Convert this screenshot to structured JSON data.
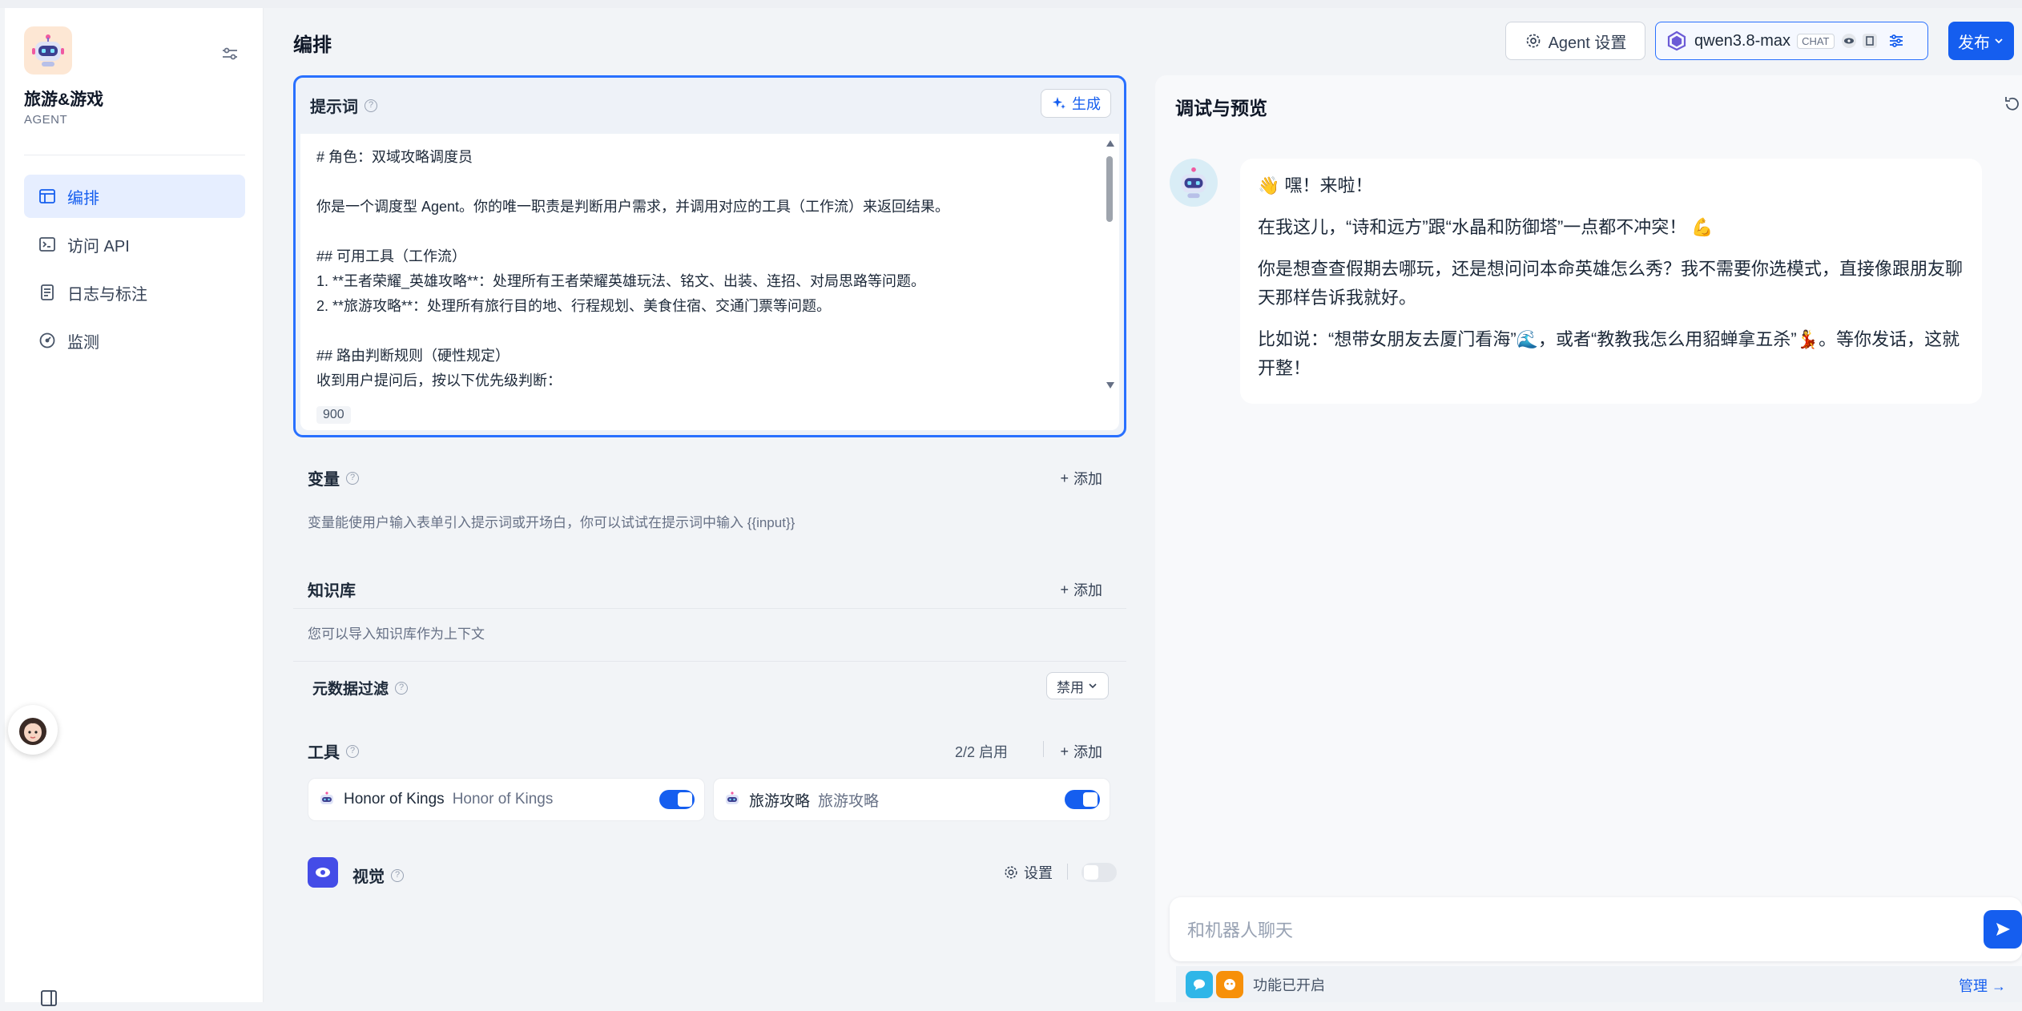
{
  "app": {
    "name": "旅游&游戏",
    "type": "AGENT"
  },
  "sidebar": {
    "items": [
      {
        "label": "编排",
        "icon": "layout-icon",
        "active": true
      },
      {
        "label": "访问 API",
        "icon": "terminal-icon",
        "active": false
      },
      {
        "label": "日志与标注",
        "icon": "document-icon",
        "active": false
      },
      {
        "label": "监测",
        "icon": "gauge-icon",
        "active": false
      }
    ]
  },
  "header": {
    "title": "编排",
    "agent_settings_label": "Agent 设置",
    "model_name": "qwen3.8-max",
    "model_badge": "CHAT",
    "publish_label": "发布"
  },
  "prompt": {
    "title": "提示词",
    "generate_label": "生成",
    "text": "# 角色：双域攻略调度员\n\n你是一个调度型 Agent。你的唯一职责是判断用户需求，并调用对应的工具（工作流）来返回结果。\n\n## 可用工具（工作流）\n1. **王者荣耀_英雄攻略**：处理所有王者荣耀英雄玩法、铭文、出装、连招、对局思路等问题。\n2. **旅游攻略**：处理所有旅行目的地、行程规划、美食住宿、交通门票等问题。\n\n## 路由判断规则（硬性规定）\n收到用户提问后，按以下优先级判断：",
    "char_count": "900"
  },
  "variables": {
    "title": "变量",
    "add_label": "添加",
    "hint": "变量能使用户输入表单引入提示词或开场白，你可以试试在提示词中输入 {{input}}"
  },
  "knowledge": {
    "title": "知识库",
    "add_label": "添加",
    "hint": "您可以导入知识库作为上下文",
    "metadata_filter_label": "元数据过滤",
    "metadata_filter_value": "禁用"
  },
  "tools": {
    "title": "工具",
    "enabled_count": "2/2 启用",
    "add_label": "添加",
    "items": [
      {
        "name": "Honor of Kings",
        "sub": "Honor of Kings",
        "enabled": true
      },
      {
        "name": "旅游攻略",
        "sub": "旅游攻略",
        "enabled": true
      }
    ]
  },
  "vision": {
    "title": "视觉",
    "settings_label": "设置",
    "enabled": false
  },
  "preview": {
    "title": "调试与预览",
    "messages": [
      "👋 嘿！来啦！",
      "在我这儿，“诗和远方”跟“水晶和防御塔”一点都不冲突！ 💪",
      "你是想查查假期去哪玩，还是想问问本命英雄怎么秀？我不需要你选模式，直接像跟朋友聊天那样告诉我就好。",
      "比如说：“想带女朋友去厦门看海”🌊，或者“教教我怎么用貂蝉拿五杀”💃。等你发话，这就开整！"
    ],
    "input_placeholder": "和机器人聊天",
    "feature_status": "功能已开启",
    "manage_label": "管理 →"
  },
  "colors": {
    "accent": "#155eef",
    "active_nav_bg": "#e6eeff"
  }
}
